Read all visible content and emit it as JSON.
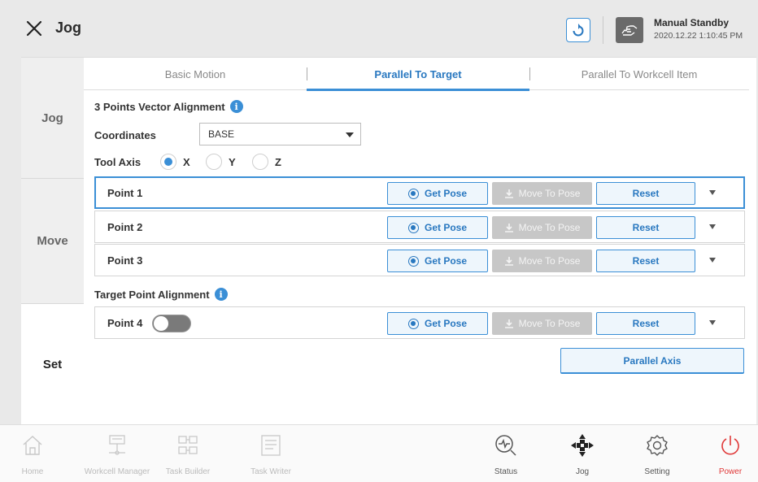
{
  "header": {
    "title": "Jog",
    "mode_title": "Manual Standby",
    "mode_time": "2020.12.22 1:10:45 PM",
    "icons": [
      "close-icon",
      "sync-icon",
      "hand-icon"
    ]
  },
  "sidebar": {
    "items": [
      {
        "label": "Jog",
        "selected": false
      },
      {
        "label": "Move",
        "selected": false
      },
      {
        "label": "Set",
        "selected": true
      }
    ]
  },
  "tabs": [
    {
      "label": "Basic Motion",
      "active": false
    },
    {
      "label": "Parallel To Target",
      "active": true
    },
    {
      "label": "Parallel To Workcell Item",
      "active": false
    }
  ],
  "alignment": {
    "title": "3 Points Vector Alignment",
    "coordinates_label": "Coordinates",
    "coordinates_value": "BASE",
    "tool_axis_label": "Tool Axis",
    "axis_options": [
      "X",
      "Y",
      "Z"
    ],
    "axis_selected": "X"
  },
  "points": [
    {
      "label": "Point 1",
      "active": true
    },
    {
      "label": "Point 2",
      "active": false
    },
    {
      "label": "Point 3",
      "active": false
    }
  ],
  "target": {
    "title": "Target Point Alignment",
    "point_label": "Point 4",
    "toggle_on": false
  },
  "buttons": {
    "get_pose": "Get Pose",
    "move_to_pose": "Move To Pose",
    "reset": "Reset",
    "parallel_axis": "Parallel Axis"
  },
  "bottom_nav": [
    {
      "label": "Home",
      "icon": "home-icon"
    },
    {
      "label": "Workcell Manager",
      "icon": "workcell-icon"
    },
    {
      "label": "Task Builder",
      "icon": "task-builder-icon"
    },
    {
      "label": "Task Writer",
      "icon": "task-writer-icon"
    },
    {
      "label": "Status",
      "icon": "status-icon"
    },
    {
      "label": "Jog",
      "icon": "jog-icon"
    },
    {
      "label": "Setting",
      "icon": "setting-icon"
    },
    {
      "label": "Power",
      "icon": "power-icon"
    }
  ],
  "colors": {
    "accent": "#3b8fd6",
    "power": "#e03a3a",
    "disabled": "#c7c7c7"
  }
}
